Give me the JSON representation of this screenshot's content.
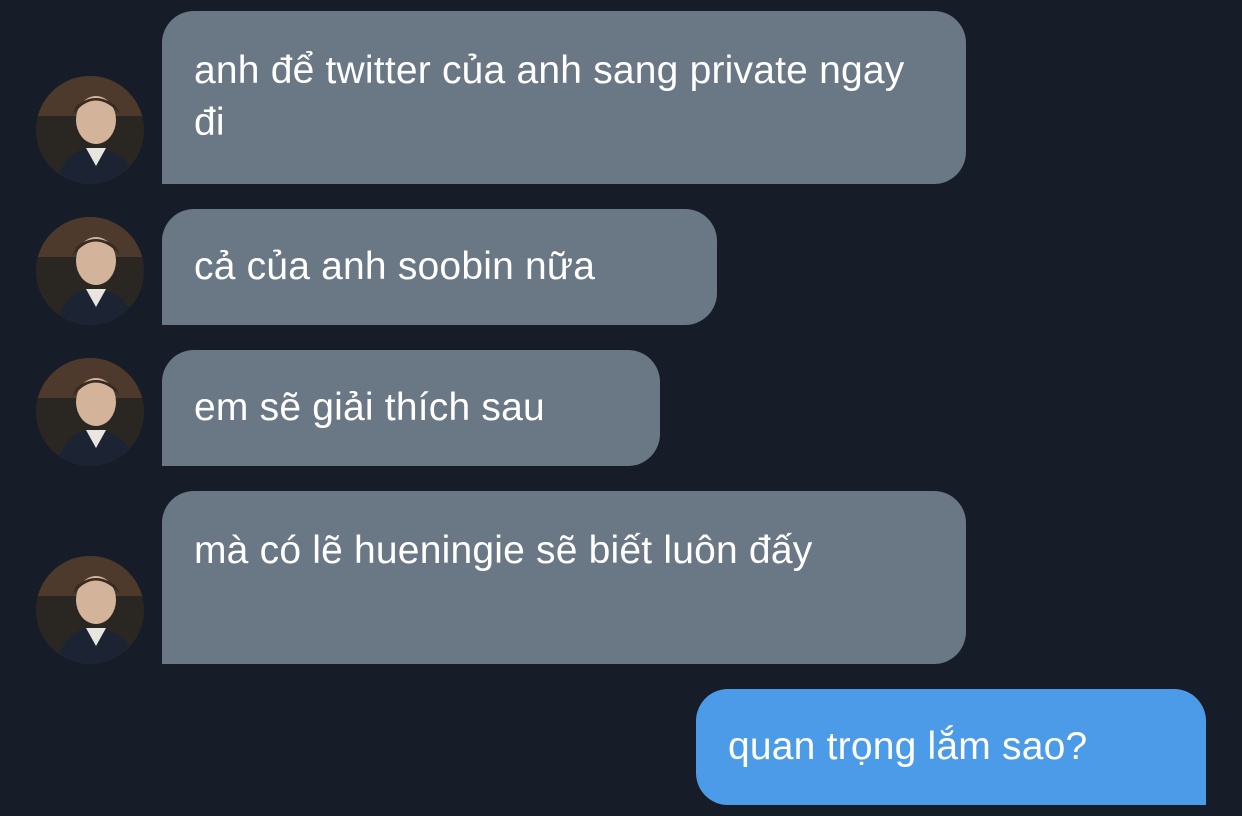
{
  "conversation": {
    "messages": [
      {
        "direction": "incoming",
        "text": "anh để twitter của anh sang private ngay đi"
      },
      {
        "direction": "incoming",
        "text": "cả của anh soobin nữa"
      },
      {
        "direction": "incoming",
        "text": "em sẽ giải thích sau"
      },
      {
        "direction": "incoming",
        "text": "mà có lẽ hueningie sẽ biết luôn đấy"
      },
      {
        "direction": "outgoing",
        "text": "quan trọng lắm sao?"
      }
    ]
  },
  "colors": {
    "background": "#161d28",
    "incoming_bubble": "#6a7784",
    "outgoing_bubble": "#4b9be8",
    "text": "#ffffff"
  },
  "icons": {
    "sender_avatar": "profile-photo"
  }
}
